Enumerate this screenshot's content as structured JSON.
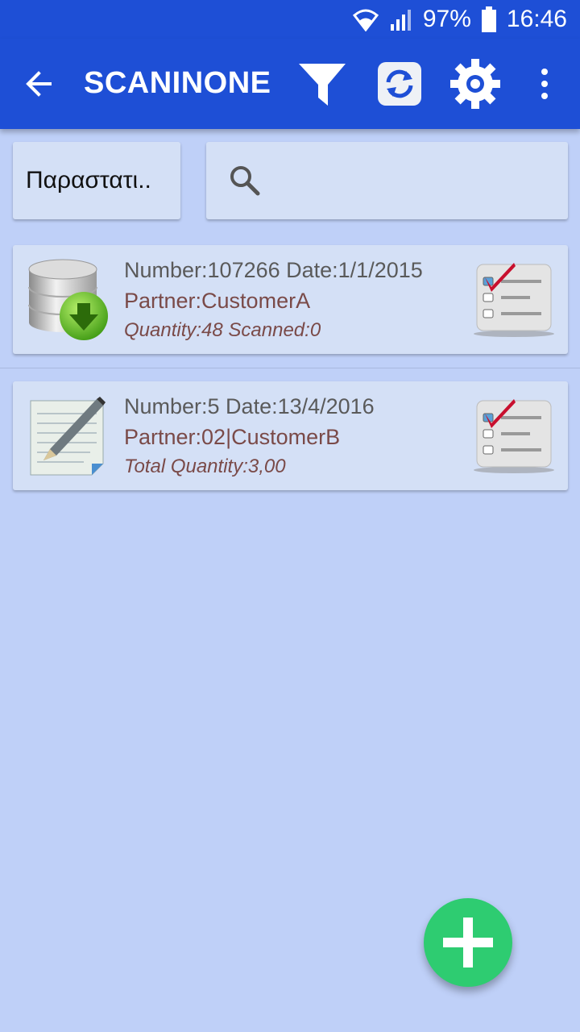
{
  "status_bar": {
    "battery_percent": "97%",
    "time": "16:46",
    "icons": [
      "wifi-icon",
      "signal-icon",
      "battery-icon"
    ]
  },
  "app_bar": {
    "title": "SCANINONE",
    "icons": [
      "back-arrow-icon",
      "filter-icon",
      "sync-icon",
      "gear-icon",
      "more-vert-icon"
    ]
  },
  "filters": {
    "doc_type_selected": "Παραστατι..",
    "search_value": ""
  },
  "documents": [
    {
      "icon": "database-download-icon",
      "line1": "Number:107266 Date:1/1/2015",
      "line2": "Partner:CustomerA",
      "line3": "Quantity:48  Scanned:0",
      "action_icon": "checklist-icon"
    },
    {
      "icon": "document-edit-icon",
      "line1": "Number:5 Date:13/4/2016",
      "line2": "Partner:02|CustomerB",
      "line3": "Total Quantity:3,00",
      "action_icon": "checklist-icon"
    }
  ],
  "colors": {
    "app_bar": "#1e4fd6",
    "background": "#bfd0f8",
    "card": "#d4e0f6",
    "partner_text": "#7a4a48",
    "fab": "#2ecc71"
  }
}
